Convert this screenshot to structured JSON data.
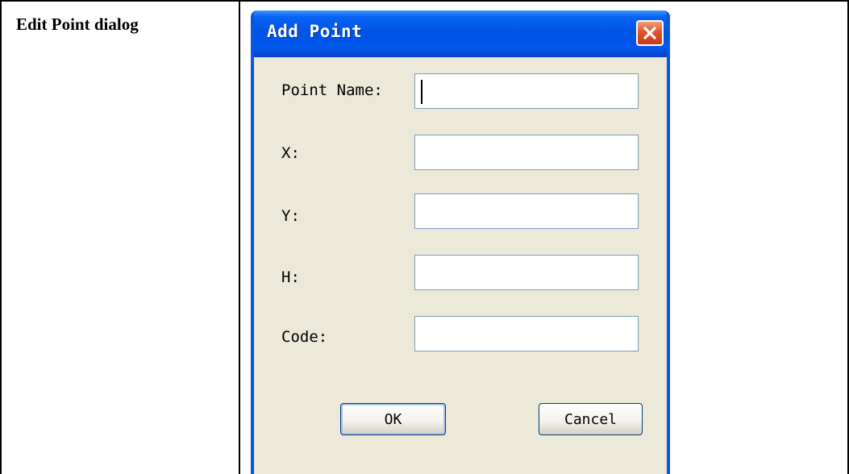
{
  "document": {
    "cell_label": "Edit Point dialog"
  },
  "dialog": {
    "title": "Add Point",
    "close_icon": "close-icon",
    "fields": [
      {
        "label": "Point Name:",
        "value": "",
        "placeholder": ""
      },
      {
        "label": "X:",
        "value": "",
        "placeholder": ""
      },
      {
        "label": "Y:",
        "value": "",
        "placeholder": ""
      },
      {
        "label": "H:",
        "value": "",
        "placeholder": ""
      },
      {
        "label": "Code:",
        "value": "",
        "placeholder": ""
      }
    ],
    "ok_label": "OK",
    "cancel_label": "Cancel"
  },
  "colors": {
    "titlebar": "#0053E4",
    "dialog_face": "#ECE9D8",
    "close_button": "#E2552A",
    "input_border": "#7F9DB9"
  }
}
